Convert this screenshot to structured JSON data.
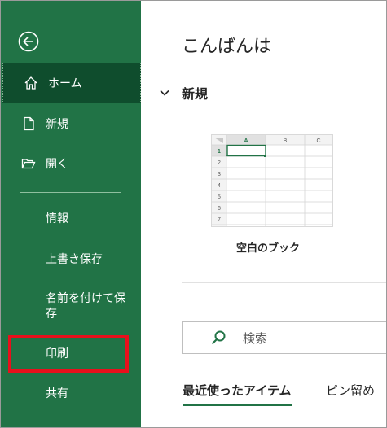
{
  "sidebar": {
    "back_icon": "back-arrow-circle-icon",
    "items": [
      {
        "label": "ホーム",
        "icon": "home-icon"
      },
      {
        "label": "新規",
        "icon": "new-document-icon"
      },
      {
        "label": "開く",
        "icon": "folder-open-icon"
      }
    ],
    "sub_items": [
      "情報",
      "上書き保存",
      "名前を付けて保\n存",
      "印刷",
      "共有"
    ],
    "highlight_color": "#e8101c",
    "bg_color": "#217346"
  },
  "main": {
    "greeting": "こんばんは",
    "new_section": "新規",
    "template": {
      "label": "空白のブック",
      "col_headers": [
        "A",
        "B",
        "C"
      ],
      "row_headers": [
        "1",
        "2",
        "3",
        "4",
        "5",
        "6",
        "7"
      ]
    },
    "search": {
      "placeholder": "検索",
      "icon": "search-icon"
    },
    "tabs": [
      "最近使ったアイテム",
      "ピン留め"
    ]
  }
}
